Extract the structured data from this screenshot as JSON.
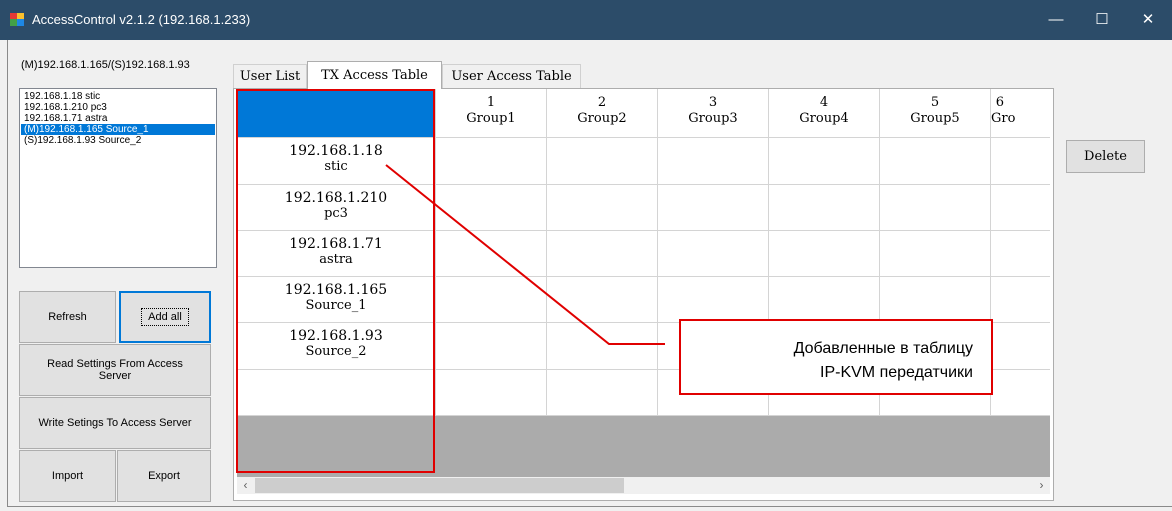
{
  "window": {
    "title": "AccessControl v2.1.2 (192.168.1.233)",
    "minimize": "—",
    "maximize": "☐",
    "close": "✕"
  },
  "server_label": "(M)192.168.1.165/(S)192.168.1.93",
  "device_list": [
    {
      "label": "192.168.1.18 stic",
      "selected": false
    },
    {
      "label": "192.168.1.210 pc3",
      "selected": false
    },
    {
      "label": "192.168.1.71 astra",
      "selected": false
    },
    {
      "label": "(M)192.168.1.165 Source_1",
      "selected": true
    },
    {
      "label": "(S)192.168.1.93 Source_2",
      "selected": false
    }
  ],
  "buttons": {
    "refresh": "Refresh",
    "add_all": "Add all",
    "read_settings": "Read Settings From Access Server",
    "write_settings": "Write Setings To Access Server",
    "import": "Import",
    "export": "Export",
    "delete": "Delete"
  },
  "tabs": [
    "User List",
    "TX Access Table",
    "User Access Table"
  ],
  "active_tab": "TX Access Table",
  "table": {
    "columns": [
      {
        "num": "1",
        "name": "Group1"
      },
      {
        "num": "2",
        "name": "Group2"
      },
      {
        "num": "3",
        "name": "Group3"
      },
      {
        "num": "4",
        "name": "Group4"
      },
      {
        "num": "5",
        "name": "Group5"
      },
      {
        "num": "6",
        "name": "Gro"
      }
    ],
    "rows": [
      {
        "ip": "192.168.1.18",
        "name": "stic"
      },
      {
        "ip": "192.168.1.210",
        "name": "pc3"
      },
      {
        "ip": "192.168.1.71",
        "name": "astra"
      },
      {
        "ip": "192.168.1.165",
        "name": "Source_1"
      },
      {
        "ip": "192.168.1.93",
        "name": "Source_2"
      },
      {
        "ip": "",
        "name": ""
      }
    ]
  },
  "scrollbar": {
    "left_arrow": "‹",
    "right_arrow": "›"
  },
  "annotation": {
    "line1": "Добавленные в таблицу",
    "line2": "IP-KVM передатчики"
  },
  "colors": {
    "titlebar": "#2c4c69",
    "selection": "#0078d7",
    "annotation": "#e00000",
    "grid_empty": "#ababab"
  }
}
